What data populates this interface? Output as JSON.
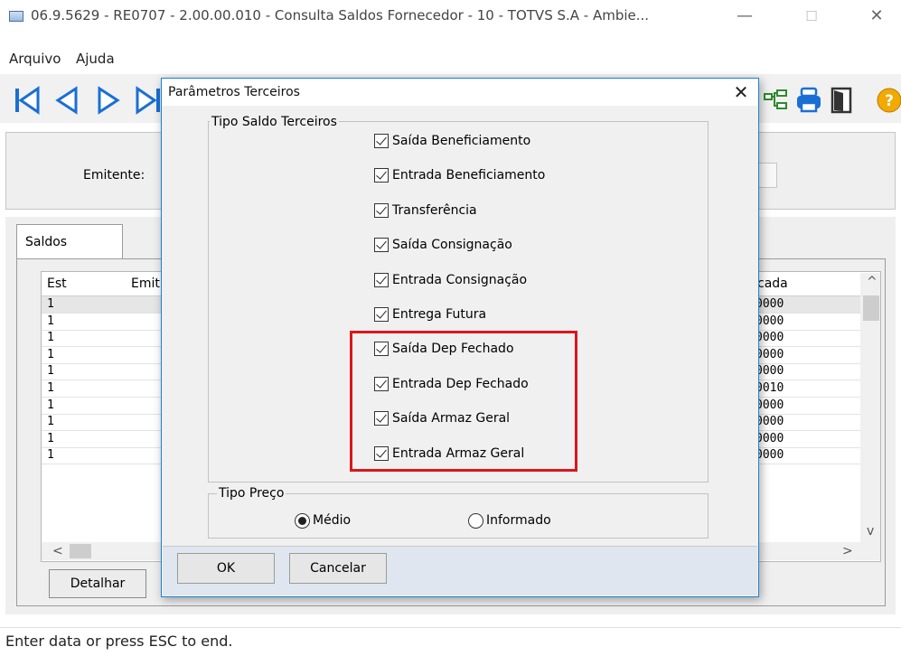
{
  "window": {
    "title": "06.9.5629 - RE0707 - 2.00.00.010 - Consulta Saldos Fornecedor - 10 - TOTVS S.A - Ambie...",
    "minimize": "—",
    "maximize": "☐",
    "close": "✕"
  },
  "menu": {
    "items": [
      "Arquivo",
      "Ajuda"
    ]
  },
  "toolbar": {
    "icons": [
      "first-record-icon",
      "previous-record-icon",
      "next-record-icon",
      "last-record-icon",
      "tree-icon",
      "print-icon",
      "exit-door-icon",
      "help-icon"
    ],
    "help_glyph": "?"
  },
  "emitente": {
    "label": "Emitente:"
  },
  "tabs": [
    {
      "label": "Saldos"
    }
  ],
  "grid": {
    "columns": [
      "Est",
      "Emit",
      "cada"
    ],
    "rows": [
      {
        "est": "1",
        "value": "0000"
      },
      {
        "est": "1",
        "value": "0000"
      },
      {
        "est": "1",
        "value": "0000"
      },
      {
        "est": "1",
        "value": "0000"
      },
      {
        "est": "1",
        "value": "0000"
      },
      {
        "est": "1",
        "value": "0010"
      },
      {
        "est": "1",
        "value": "0000"
      },
      {
        "est": "1",
        "value": "0000"
      },
      {
        "est": "1",
        "value": "0000"
      },
      {
        "est": "1",
        "value": "0000"
      }
    ],
    "scroll_up": "^",
    "scroll_down": "v",
    "scroll_left": "<",
    "scroll_right": ">"
  },
  "detalhar_label": "Detalhar",
  "status": "Enter data or press ESC to end.",
  "dialog": {
    "title": "Parâmetros Terceiros",
    "close": "✕",
    "group1_label": "Tipo Saldo Terceiros",
    "options": [
      {
        "label": "Saída Beneficiamento",
        "checked": true
      },
      {
        "label": "Entrada Beneficiamento",
        "checked": true
      },
      {
        "label": "Transferência",
        "checked": true
      },
      {
        "label": "Saída Consignação",
        "checked": true
      },
      {
        "label": "Entrada Consignação",
        "checked": true
      },
      {
        "label": "Entrega Futura",
        "checked": true
      },
      {
        "label": "Saída Dep Fechado",
        "checked": true
      },
      {
        "label": "Entrada Dep Fechado",
        "checked": true
      },
      {
        "label": "Saída Armaz Geral",
        "checked": true
      },
      {
        "label": "Entrada Armaz Geral",
        "checked": true
      }
    ],
    "group2_label": "Tipo Preço",
    "radios": [
      {
        "label": "Médio",
        "selected": true
      },
      {
        "label": "Informado",
        "selected": false
      }
    ],
    "ok_label": "OK",
    "cancel_label": "Cancelar",
    "highlight_color": "#d9171d"
  }
}
